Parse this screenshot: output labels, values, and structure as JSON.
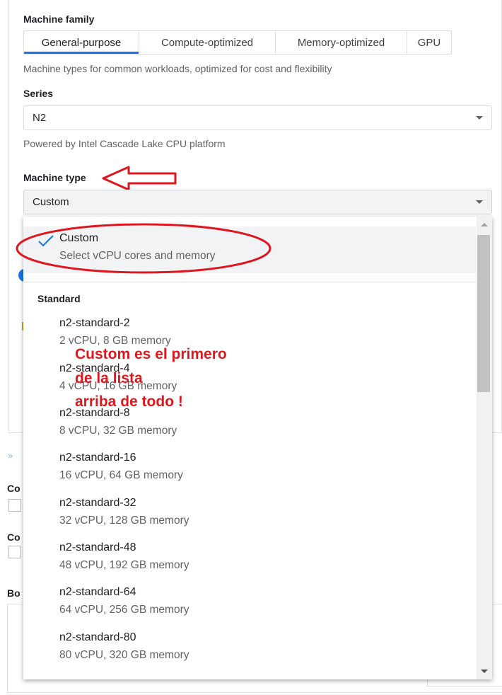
{
  "machine_family": {
    "label": "Machine family",
    "tabs": [
      "General-purpose",
      "Compute-optimized",
      "Memory-optimized",
      "GPU"
    ],
    "description": "Machine types for common workloads, optimized for cost and flexibility"
  },
  "series": {
    "label": "Series",
    "value": "N2",
    "description": "Powered by Intel Cascade Lake CPU platform"
  },
  "machine_type": {
    "label": "Machine type",
    "value": "Custom",
    "dropdown": {
      "selected": {
        "title": "Custom",
        "subtitle": "Select vCPU cores and memory"
      },
      "group_label": "Standard",
      "items": [
        {
          "title": "n2-standard-2",
          "subtitle": "2 vCPU, 8 GB memory"
        },
        {
          "title": "n2-standard-4",
          "subtitle": "4 vCPU, 16 GB memory"
        },
        {
          "title": "n2-standard-8",
          "subtitle": "8 vCPU, 32 GB memory"
        },
        {
          "title": "n2-standard-16",
          "subtitle": "16 vCPU, 64 GB memory"
        },
        {
          "title": "n2-standard-32",
          "subtitle": "32 vCPU, 128 GB memory"
        },
        {
          "title": "n2-standard-48",
          "subtitle": "48 vCPU, 192 GB memory"
        },
        {
          "title": "n2-standard-64",
          "subtitle": "64 vCPU, 256 GB memory"
        },
        {
          "title": "n2-standard-80",
          "subtitle": "80 vCPU, 320 GB memory"
        }
      ]
    }
  },
  "annotation": {
    "lines": [
      "Custom es el primero",
      "de la lista",
      "arriba de todo !"
    ],
    "color": "#e0161e"
  },
  "background": {
    "label_1": "Co",
    "label_2": "Co",
    "label_3": "Bo"
  },
  "colors": {
    "accent": "#1a73e8",
    "annotation": "#e0161e"
  }
}
